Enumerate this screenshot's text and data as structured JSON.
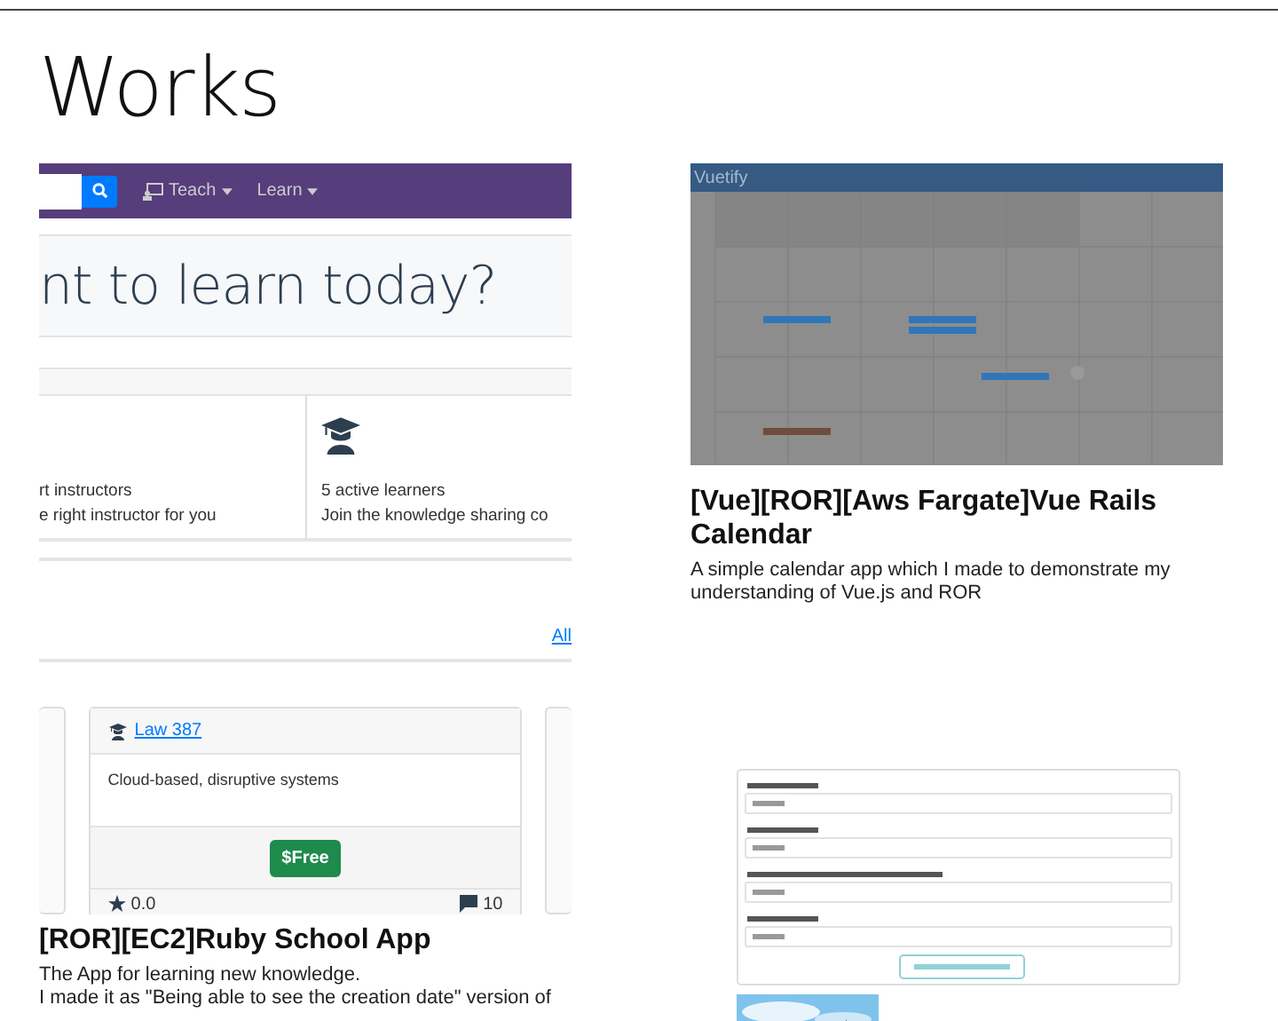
{
  "page": {
    "title": "Works"
  },
  "works_left": [
    {
      "screenshot": {
        "kind": "learning_home",
        "nav_items": [
          {
            "label": "Teach",
            "kind": "teach"
          },
          {
            "label": "Learn",
            "kind": "plain"
          }
        ],
        "hero": "nt to learn today?",
        "features": [
          {
            "title": "rt instructors",
            "text": "e right instructor for you",
            "kind": "plain"
          },
          {
            "title": "5 active learners",
            "text": "Join the knowledge sharing co",
            "kind": "cap"
          }
        ],
        "link": "All"
      }
    },
    {
      "screenshot": {
        "kind": "course_cards",
        "course": {
          "name": "Law 387",
          "description": "Cloud-based, disruptive systems",
          "price": "$Free",
          "rating": "0.0",
          "count": "10"
        }
      },
      "title": "[ROR][EC2]Ruby School App",
      "description": [
        "The App for learning new knowledge.",
        "I made it as \"Being able to see the creation date\" version of"
      ]
    }
  ],
  "works_right": [
    {
      "screenshot": {
        "kind": "calendar",
        "brand": "Vuetify"
      },
      "title": "[Vue][ROR][Aws Fargate]Vue Rails Calendar",
      "description": [
        "A simple calendar app which I made to demonstrate my understanding of Vue.js and ROR"
      ]
    },
    {
      "screenshot": {
        "kind": "golf_form"
      }
    }
  ]
}
